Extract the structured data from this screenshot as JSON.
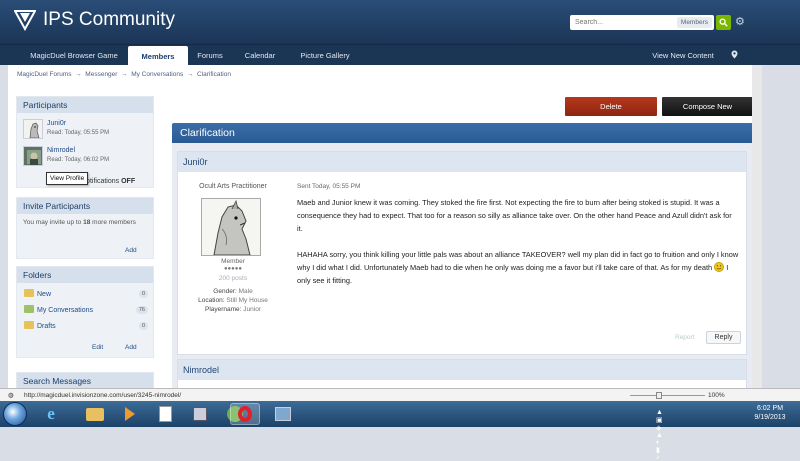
{
  "header": {
    "site_title": "IPS Community",
    "search_placeholder": "Search...",
    "search_scope": "Members"
  },
  "nav": {
    "tabs": [
      "MagicDuel Browser Game",
      "Members",
      "Forums",
      "Calendar",
      "Picture Gallery"
    ],
    "active_tab": "Members",
    "right_link": "View New Content"
  },
  "breadcrumb": [
    "MagicDuel Forums",
    "Messenger",
    "My Conversations",
    "Clarification"
  ],
  "breadcrumb_sep": "→",
  "sidebar": {
    "participants_title": "Participants",
    "participants": [
      {
        "name": "Juni0r",
        "read": "Read: Today, 05:55 PM"
      },
      {
        "name": "Nimrodel",
        "read": "Read: Today, 06:02 PM"
      }
    ],
    "tooltip": "View Profile",
    "notifications_text": "Notifications",
    "notifications_state": "OFF",
    "invite_title": "Invite Participants",
    "invite_text_1": "You may invite up to ",
    "invite_count": "18",
    "invite_text_2": " more members",
    "add_label": "Add",
    "folders_title": "Folders",
    "folders": [
      {
        "name": "New",
        "count": "0"
      },
      {
        "name": "My Conversations",
        "count": "76"
      },
      {
        "name": "Drafts",
        "count": "0"
      }
    ],
    "edit_label": "Edit",
    "search_title": "Search Messages"
  },
  "main": {
    "delete_label": "Delete",
    "compose_label": "Compose New",
    "topic_title": "Clarification",
    "post": {
      "author": "Juni0r",
      "author_title": "Ocult Arts Practitioner",
      "group": "Member",
      "pips": "●●●●●",
      "post_count": "200 posts",
      "gender_label": "Gender:",
      "gender": "Male",
      "location_label": "Location:",
      "location": "Still My House",
      "playername_label": "Playername:",
      "playername": "Junior",
      "sent": "Sent Today, 05:55 PM",
      "para1": "Maeb and Junior knew it was coming. They stoked the fire first. Not expecting the fire to burn after being stoked is stupid. It was a consequence they had to expect. That too for a reason so silly as alliance take over. On the other hand Peace and Azull didn't ask for it.",
      "para2_a": "HAHAHA sorry, you think killing your little pals was about an alliance TAKEOVER? well my plan did in fact go to fruition and only I know why I did what I did. Unfortunately Maeb had to die when he only was doing me a favor but i'll take care of that. As for my death",
      "para2_b": " I only see it fitting.",
      "report_label": "Report",
      "reply_label": "Reply"
    },
    "post2_author": "Nimrodel"
  },
  "status": {
    "url": "http://magicduel.invisionzone.com/user/3245-nimrodel/",
    "zoom": "100%"
  },
  "taskbar": {
    "time": "6:02 PM",
    "date": "9/19/2013"
  }
}
